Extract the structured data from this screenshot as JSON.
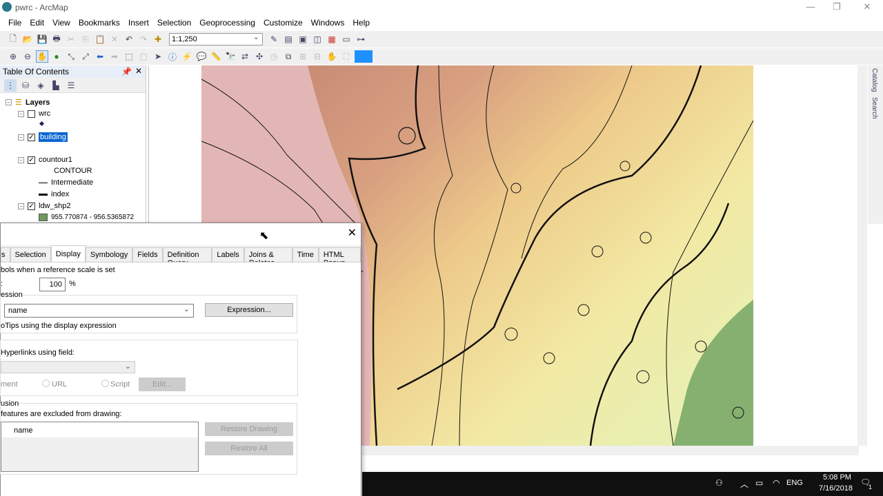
{
  "window": {
    "title": "pwrc - ArcMap"
  },
  "menu": [
    "File",
    "Edit",
    "View",
    "Bookmarks",
    "Insert",
    "Selection",
    "Geoprocessing",
    "Customize",
    "Windows",
    "Help"
  ],
  "toolbar": {
    "scale": "1:1,250"
  },
  "toc": {
    "title": "Table Of Contents",
    "root": "Layers",
    "layers": [
      {
        "name": "wrc",
        "checked": false
      },
      {
        "name": "building",
        "checked": true,
        "selected": true
      },
      {
        "name": "countour1",
        "checked": true,
        "field": "CONTOUR",
        "legend": [
          "Intermediate",
          "index"
        ]
      },
      {
        "name": "ldw_shp2",
        "checked": true,
        "class": "955.770874 - 956.5365872",
        "class_color": "#6f9a5a"
      }
    ]
  },
  "right_tabs": [
    "Catalog",
    "Search"
  ],
  "dialog": {
    "tabs": [
      "s",
      "Selection",
      "Display",
      "Symbology",
      "Fields",
      "Definition Query",
      "Labels",
      "Joins & Relates",
      "Time",
      "HTML Popup"
    ],
    "active_tab": "Display",
    "scale_symbols_text": "bols when a reference scale is set",
    "scale_value": "100",
    "percent": "%",
    "colon": ":",
    "expression_group": "ession",
    "field_value": "name",
    "expression_button": "Expression...",
    "maptips_text": "oTips using the display expression",
    "hyperlinks_text": "Hyperlinks using field:",
    "document_text": "ment",
    "url_label": "URL",
    "script_label": "Script",
    "edit_button": "Edit...",
    "exclusion_group": "usion",
    "excluded_text": " features are excluded from drawing:",
    "list_header": "name",
    "restore_drawing": "Restore Drawing",
    "restore_all": "Restore All"
  },
  "taskbar": {
    "language": "ENG",
    "time": "5:08 PM",
    "date": "7/16/2018",
    "notifications": "1"
  }
}
